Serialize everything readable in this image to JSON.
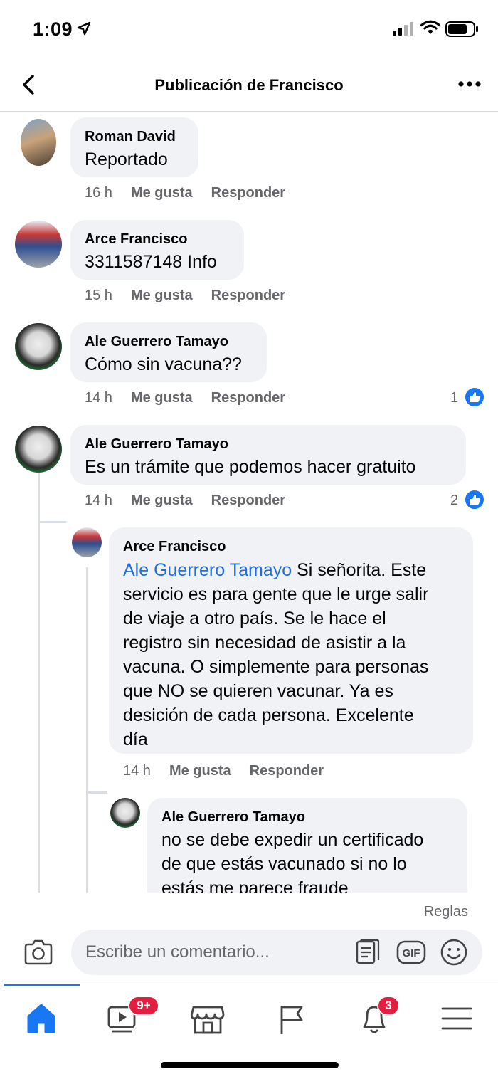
{
  "status_bar": {
    "time": "1:09"
  },
  "nav": {
    "title": "Publicación de Francisco"
  },
  "comments": [
    {
      "author": "Roman David",
      "text": "Reportado",
      "time": "16 h",
      "like_label": "Me gusta",
      "reply_label": "Responder"
    },
    {
      "author": "Arce Francisco",
      "text": "3311587148 Info",
      "time": "15 h",
      "like_label": "Me gusta",
      "reply_label": "Responder"
    },
    {
      "author": "Ale Guerrero Tamayo",
      "text": "Cómo sin vacuna??",
      "time": "14 h",
      "like_label": "Me gusta",
      "reply_label": "Responder",
      "reactions": "1"
    },
    {
      "author": "Ale Guerrero Tamayo",
      "text": "Es un trámite que podemos hacer gratuito",
      "time": "14 h",
      "like_label": "Me gusta",
      "reply_label": "Responder",
      "reactions": "2"
    }
  ],
  "replies": [
    {
      "author": "Arce Francisco",
      "mention": "Ale Guerrero Tamayo",
      "lines": [
        "Si señorita. Este",
        "servicio es para gente que le urge salir",
        "de viaje a otro país. Se le hace el",
        "registro sin necesidad de asistir a la",
        "vacuna. O simplemente para personas",
        "que NO se quieren vacunar. Ya es",
        "desición de cada persona. Excelente",
        "día"
      ],
      "time": "14 h",
      "like_label": "Me gusta",
      "reply_label": "Responder"
    },
    {
      "author": "Ale Guerrero Tamayo",
      "lines": [
        "no se debe expedir un certificado",
        "de que estás vacunado si no lo",
        "estás me parece fraude"
      ]
    }
  ],
  "composer": {
    "rules": "Reglas",
    "placeholder": "Escribe un comentario...",
    "gif_label": "GIF"
  },
  "tabbar": {
    "watch_badge": "9+",
    "notifications_badge": "3"
  },
  "colors": {
    "accent": "#1877f2",
    "bubble": "#f0f2f5",
    "badge": "#e41e3f",
    "meta": "#65676b"
  },
  "icons": [
    "location-arrow-icon",
    "signal-icon",
    "wifi-icon",
    "battery-icon",
    "back-chevron-icon",
    "more-dots-icon",
    "like-reaction-icon",
    "camera-icon",
    "sticker-icon",
    "gif-icon",
    "emoji-icon",
    "home-icon",
    "watch-icon",
    "marketplace-icon",
    "pages-flag-icon",
    "bell-icon",
    "menu-icon"
  ]
}
